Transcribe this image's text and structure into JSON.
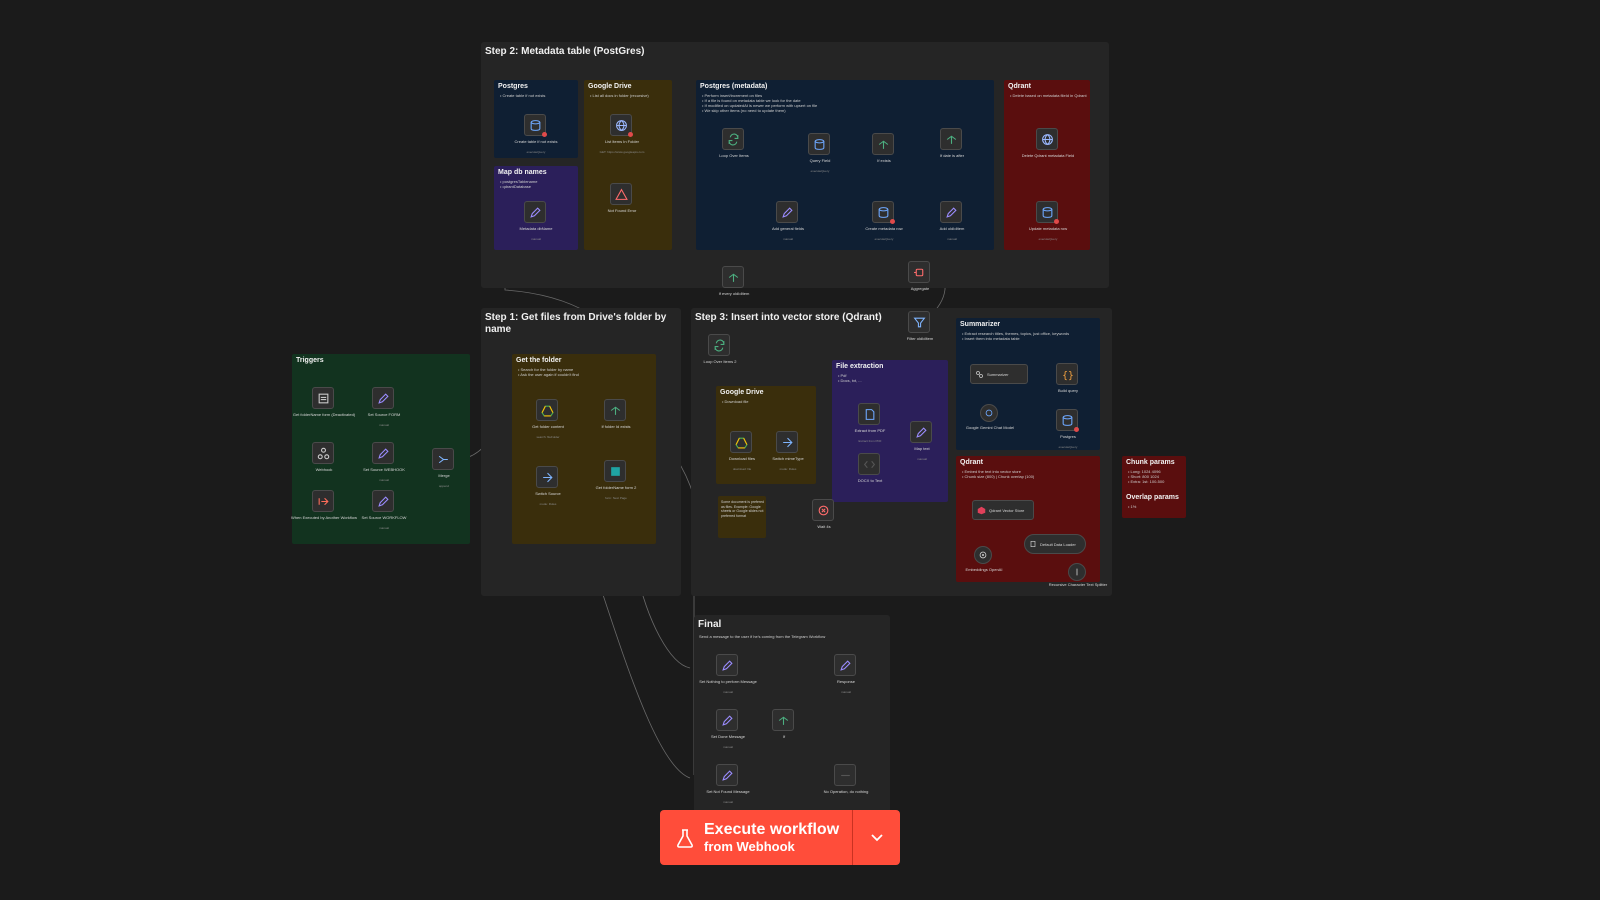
{
  "colors": {
    "background": "#1b1b1b",
    "section": "#252525",
    "sticky_green": "#12331f",
    "sticky_yellow": "#3a2e0c",
    "sticky_purple": "#2b1f5a",
    "sticky_navy": "#0f1f33",
    "sticky_red": "#5a0e0e",
    "accent": "#ff4d3a"
  },
  "sections": {
    "step2": "Step 2: Metadata table (PostGres)",
    "step1": "Step 1: Get files from Drive's folder by name",
    "step3": "Step 3: Insert into vector store (Qdrant)",
    "final": "Final"
  },
  "stickies": {
    "triggers": {
      "title": "Triggers"
    },
    "postgres": {
      "title": "Postgres",
      "notes": [
        "Create table if not exists"
      ]
    },
    "gdrive_top": {
      "title": "Google Drive",
      "notes": [
        "List all docs in folder (recursive)"
      ]
    },
    "map_db": {
      "title": "Map db names",
      "notes": [
        "postgresTablename",
        "qdrantDatabase"
      ]
    },
    "postgres_meta": {
      "title": "Postgres (metadata)",
      "notes": [
        "Perform insert/increment on files",
        "If a file is found on metadata table we look for the date",
        "If modified on updatedAt is newer we perform with upsert on file",
        "We skip other items (no need to update them)"
      ]
    },
    "qdrant_top": {
      "title": "Qdrant",
      "notes": [
        "Delete based on metadata fileId in Qdrant"
      ]
    },
    "get_folder": {
      "title": "Get the folder",
      "notes": [
        "Search for the folder by name",
        "Ask the user again if couldn't find"
      ]
    },
    "gdrive_mid": {
      "title": "Google Drive",
      "notes": [
        "Download file"
      ]
    },
    "file_extraction": {
      "title": "File extraction",
      "notes": [
        "Pdf",
        "Docs, txt, ..."
      ]
    },
    "summarizer": {
      "title": "Summarizer",
      "notes": [
        "Extract research titles, themes, topics, just office, keywords",
        "Insert them into metadata table"
      ]
    },
    "qdrant_mid": {
      "title": "Qdrant",
      "notes": [
        "Embed the text into vector store",
        "Chunk size (800) | Chunk overlap (100)"
      ]
    },
    "params": {
      "title": "Chunk params",
      "notes": [
        "Long: 1024 4096",
        "Short: 800 1024",
        "Extra: 1st: 100-500"
      ],
      "title2": "Overlap params",
      "notes2": [
        "1%"
      ]
    },
    "final_note": "Send a message to the user if he's coming from the Telegram Workflow",
    "small_note": "Some document is prefered as files. Example: Google sheets or Google slides not preferred format"
  },
  "nodes": {
    "get_folder_form": {
      "label": "Get folderName form (Deactivated)",
      "sub": ""
    },
    "set_source_form": {
      "label": "Set Source FORM",
      "sub": "manual"
    },
    "webhook": {
      "label": "Webhook",
      "sub": ""
    },
    "set_source_webhook": {
      "label": "Set Source WEBHOOK",
      "sub": "manual"
    },
    "when_executed": {
      "label": "When Executed by Another Workflow",
      "sub": ""
    },
    "set_source_workflow": {
      "label": "Set Source WORKFLOW",
      "sub": "manual"
    },
    "merge": {
      "label": "Merge",
      "sub": "append"
    },
    "get_folder_content": {
      "label": "Get folder content",
      "sub": "search: fileFolder"
    },
    "if_folder_exists": {
      "label": "If folder Id exists",
      "sub": ""
    },
    "switch_source": {
      "label": "Switch Source",
      "sub": "mode: Rules"
    },
    "get_folder_name_2": {
      "label": "Get folderName form 2",
      "sub": "form: Next Page"
    },
    "create_table": {
      "label": "Create table if not exists",
      "sub": "executeQuery"
    },
    "list_items": {
      "label": "List Items In Folder",
      "sub": "GET: https://www.googleapis.com"
    },
    "not_found_error": {
      "label": "Not Found Error",
      "sub": ""
    },
    "metadata_db": {
      "label": "Metadata dbName",
      "sub": "manual"
    },
    "loop_over": {
      "label": "Loop Over Items",
      "sub": ""
    },
    "query_field": {
      "label": "Query Field",
      "sub": "executeQuery"
    },
    "if_exists": {
      "label": "If exists",
      "sub": ""
    },
    "if_date": {
      "label": "If date is after",
      "sub": ""
    },
    "add_general": {
      "label": "Add general fields",
      "sub": "manual"
    },
    "create_metadata": {
      "label": "Create metadata row",
      "sub": "executeQuery"
    },
    "add_old_ids": {
      "label": "Add oldIdItem",
      "sub": "manual"
    },
    "delete_qdrant": {
      "label": "Delete Qdrant metadata Field",
      "sub": ""
    },
    "update_metadata": {
      "label": "Update metadata row",
      "sub": "executeQuery"
    },
    "if_every": {
      "label": "If every oldIdItem",
      "sub": ""
    },
    "aggregate": {
      "label": "Aggregate",
      "sub": ""
    },
    "filter_old": {
      "label": "Filter oldIdItem",
      "sub": ""
    },
    "loop_over_2": {
      "label": "Loop Over Items 2",
      "sub": ""
    },
    "download_files": {
      "label": "Download files",
      "sub": "download: file"
    },
    "switch_mime": {
      "label": "Switch mimeType",
      "sub": "mode: Rules"
    },
    "extract_pdf": {
      "label": "Extract from PDF",
      "sub": "Extract from PDF"
    },
    "docx_to_text": {
      "label": "DOCX to Text",
      "sub": ""
    },
    "map_text": {
      "label": "Map text",
      "sub": "manual"
    },
    "wait": {
      "label": "Wait 4s",
      "sub": ""
    },
    "summarizer": {
      "label": "Summarizer",
      "sub": ""
    },
    "build_query": {
      "label": "Build query",
      "sub": ""
    },
    "gemini": {
      "label": "Google Gemini Chat Model",
      "sub": ""
    },
    "postgres_sum": {
      "label": "Postgres",
      "sub": "executeQuery"
    },
    "qdrant_store": {
      "label": "Qdrant Vector Store",
      "sub": ""
    },
    "default_loader": {
      "label": "Default Data Loader",
      "sub": ""
    },
    "embeddings": {
      "label": "Embeddings OpenAI",
      "sub": ""
    },
    "recursive_splitter": {
      "label": "Recursive Character Text Splitter",
      "sub": ""
    },
    "set_nothing": {
      "label": "Set Nothing to perform Message",
      "sub": "manual"
    },
    "set_done": {
      "label": "Set Done Message",
      "sub": "manual"
    },
    "set_not_found": {
      "label": "Set Not Found Message",
      "sub": "manual"
    },
    "if_final": {
      "label": "If",
      "sub": ""
    },
    "response": {
      "label": "Response",
      "sub": "manual"
    },
    "no_op": {
      "label": "No Operation, do nothing",
      "sub": ""
    }
  },
  "execute": {
    "line1": "Execute workflow",
    "line2": "from Webhook"
  },
  "icons": [
    "flask-icon",
    "chevron-down-icon",
    "pencil-icon",
    "webhook-icon",
    "form-icon",
    "merge-icon",
    "drive-icon",
    "if-icon",
    "switch-icon",
    "database-icon",
    "globe-icon",
    "loop-icon",
    "warning-icon",
    "filter-icon",
    "aggregate-icon",
    "pdf-icon",
    "wait-icon",
    "code-icon",
    "gemini-icon",
    "qdrant-icon",
    "trigger-icon"
  ]
}
